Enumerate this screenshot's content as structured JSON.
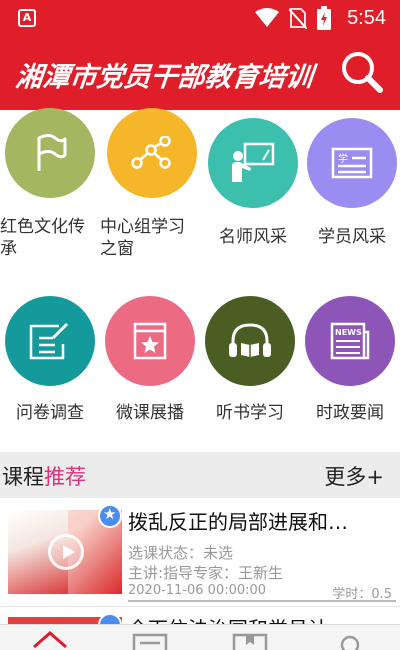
{
  "status_bar": {
    "app_icon_letter": "A",
    "time": "5:54",
    "icons": [
      "wifi-icon",
      "no-sim-icon",
      "battery-charging-icon"
    ]
  },
  "header": {
    "title": "湘潭市党员干部教育培训",
    "search_icon": "search-icon",
    "background_color": "#e01e2a"
  },
  "grid": {
    "items": [
      {
        "label": "红色文化传承",
        "icon": "flag-icon",
        "color": "#a5b661"
      },
      {
        "label": "中心组学习之窗",
        "icon": "network-icon",
        "color": "#f5b62a"
      },
      {
        "label": "名师风采",
        "icon": "teacher-board-icon",
        "color": "#3dbfae"
      },
      {
        "label": "学员风采",
        "icon": "student-card-icon",
        "color": "#9a8cf0"
      },
      {
        "label": "问卷调查",
        "icon": "questionnaire-icon",
        "color": "#159a9c"
      },
      {
        "label": "微课展播",
        "icon": "star-video-icon",
        "color": "#ec6a82"
      },
      {
        "label": "听书学习",
        "icon": "headphones-book-icon",
        "color": "#4a5e23"
      },
      {
        "label": "时政要闻",
        "icon": "newspaper-icon",
        "color": "#8e55b8"
      }
    ]
  },
  "section": {
    "title_plain": "课程",
    "title_accent": "推荐",
    "more": "更多+",
    "accent_color": "#e0307a"
  },
  "courses": [
    {
      "title": "拨乱反正的局部进展和…",
      "status": "选课状态：未选",
      "lecturer": "主讲:指导专家：王新生",
      "date": "2020-11-06 00:00:00",
      "hours": "学时：0.5"
    },
    {
      "title": "全面依法治国和党员计…"
    }
  ],
  "tabbar": {
    "items": [
      "home-icon",
      "course-list-icon",
      "bookmark-icon",
      "profile-icon"
    ]
  }
}
